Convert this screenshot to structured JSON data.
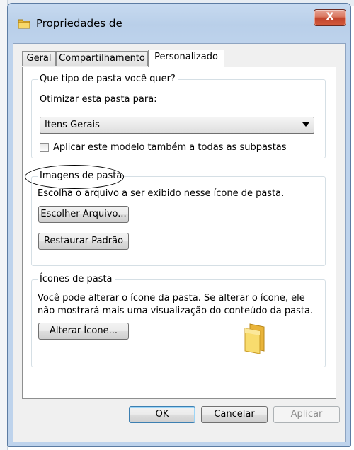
{
  "window": {
    "title": "Propriedades de",
    "close_label": "X"
  },
  "tabs": [
    {
      "label": "Geral",
      "active": false
    },
    {
      "label": "Compartilhamento",
      "active": false
    },
    {
      "label": "Personalizado",
      "active": true
    }
  ],
  "folder_type": {
    "legend": "Que tipo de pasta você quer?",
    "optimize_label": "Otimizar esta pasta para:",
    "selected_value": "Itens Gerais",
    "apply_subfolders_label": "Aplicar este modelo também a todas as subpastas",
    "apply_subfolders_checked": false
  },
  "folder_pictures": {
    "legend": "Imagens de pasta",
    "description": "Escolha o arquivo a ser exibido nesse ícone de pasta.",
    "choose_file_label": "Escolher Arquivo...",
    "restore_default_label": "Restaurar Padrão"
  },
  "folder_icons": {
    "legend": "Ícones de pasta",
    "description_line1": "Você pode alterar o ícone da pasta. Se alterar o ícone, ele",
    "description_line2": "não mostrará mais uma visualização do conteúdo da pasta.",
    "change_icon_label": "Alterar Ícone...",
    "preview_icon": "folder-icon"
  },
  "footer": {
    "ok_label": "OK",
    "cancel_label": "Cancelar",
    "apply_label": "Aplicar"
  },
  "colors": {
    "title_gradient_top": "#c7daf0",
    "close_button": "#c2462e",
    "panel_background": "#ffffff",
    "default_button_border": "#3c7fb1",
    "folder_yellow": "#f4d35e"
  }
}
